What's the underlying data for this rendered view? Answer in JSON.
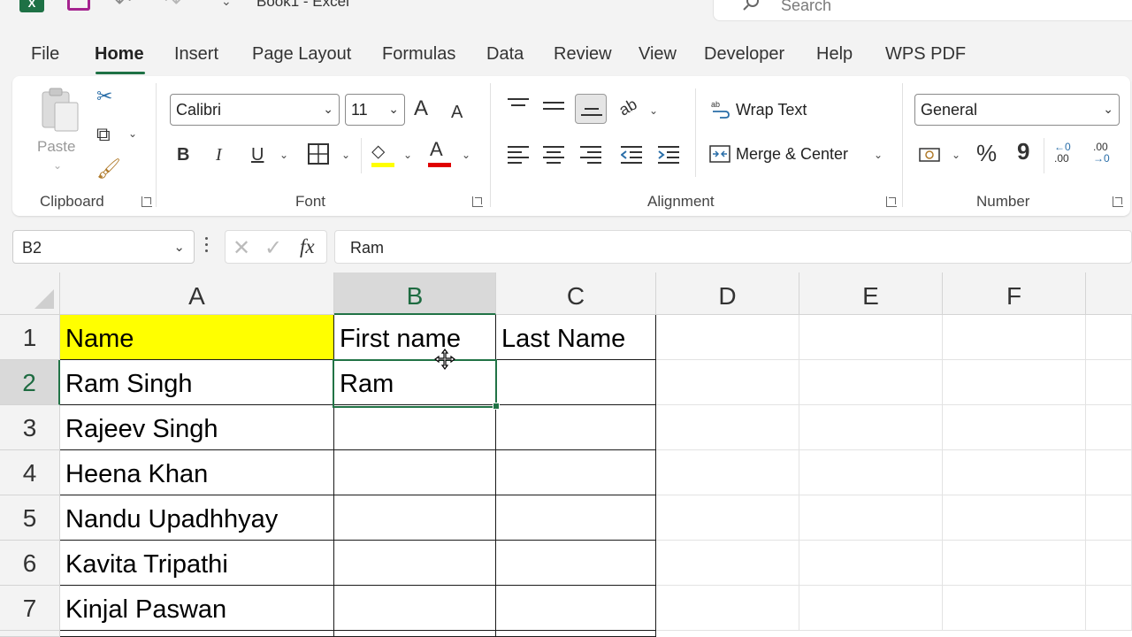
{
  "titlebar": {
    "title": "Book1  -  Excel",
    "search_placeholder": "Search"
  },
  "menu": {
    "tabs": [
      "File",
      "Home",
      "Insert",
      "Page Layout",
      "Formulas",
      "Data",
      "Review",
      "View",
      "Developer",
      "Help",
      "WPS PDF"
    ],
    "active": "Home"
  },
  "ribbon": {
    "clipboard": {
      "paste_label": "Paste",
      "group_label": "Clipboard"
    },
    "font": {
      "font_name": "Calibri",
      "font_size": "11",
      "group_label": "Font",
      "bold": "B",
      "italic": "I",
      "underline": "U",
      "grow": "A",
      "shrink": "A",
      "font_color": "A"
    },
    "alignment": {
      "wrap_text": "Wrap Text",
      "merge_center": "Merge & Center",
      "group_label": "Alignment",
      "orientation_glyph": "ab"
    },
    "number": {
      "format": "General",
      "group_label": "Number",
      "percent": "%",
      "comma": "9",
      "inc_decimal_top": "←0",
      "inc_decimal_bottom": ".00",
      "dec_decimal_top": ".00",
      "dec_decimal_bottom": "→0"
    }
  },
  "formula_bar": {
    "name_box": "B2",
    "fx": "fx",
    "content": "Ram"
  },
  "grid": {
    "columns": [
      "A",
      "B",
      "C",
      "D",
      "E",
      "F"
    ],
    "rows": [
      "1",
      "2",
      "3",
      "4",
      "5",
      "6",
      "7"
    ],
    "cells": {
      "A1": "Name",
      "B1": "First name",
      "C1": "Last Name",
      "A2": "Ram Singh",
      "B2": "Ram",
      "A3": "Rajeev Singh",
      "A4": "Heena Khan",
      "A5": "Nandu Upadhhyay",
      "A6": "Kavita Tripathi",
      "A7": "Kinjal Paswan"
    },
    "highlight_color": "#ffff00",
    "selection_color": "#217346",
    "active_cell": "B2"
  }
}
